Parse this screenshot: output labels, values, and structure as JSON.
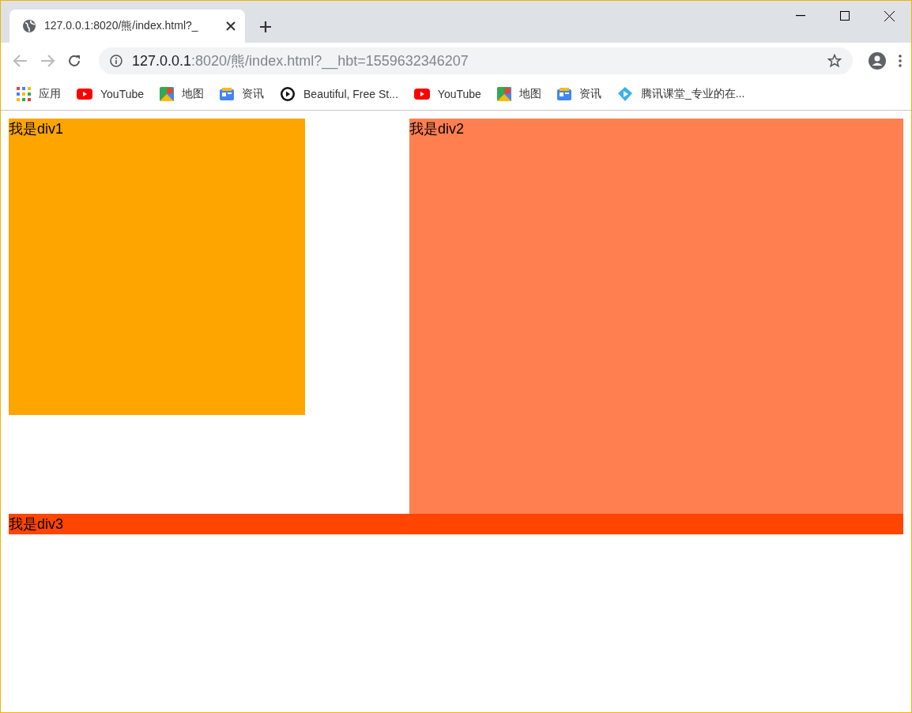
{
  "tab": {
    "title": "127.0.0.1:8020/熊/index.html?_"
  },
  "address": {
    "host": "127.0.0.1",
    "rest": ":8020/熊/index.html?__hbt=1559632346207"
  },
  "bookmarks": [
    {
      "kind": "apps",
      "label": "应用"
    },
    {
      "kind": "youtube",
      "label": "YouTube"
    },
    {
      "kind": "maps",
      "label": "地图"
    },
    {
      "kind": "news",
      "label": "资讯"
    },
    {
      "kind": "play",
      "label": "Beautiful, Free St..."
    },
    {
      "kind": "youtube",
      "label": "YouTube"
    },
    {
      "kind": "maps",
      "label": "地图"
    },
    {
      "kind": "news",
      "label": "资讯"
    },
    {
      "kind": "tencent",
      "label": "腾讯课堂_专业的在..."
    }
  ],
  "boxes": [
    {
      "label": "我是div1",
      "color": "#ffa500"
    },
    {
      "label": "我是div2",
      "color": "#ff7f50"
    },
    {
      "label": "我是div3",
      "color": "#ff4500"
    }
  ]
}
